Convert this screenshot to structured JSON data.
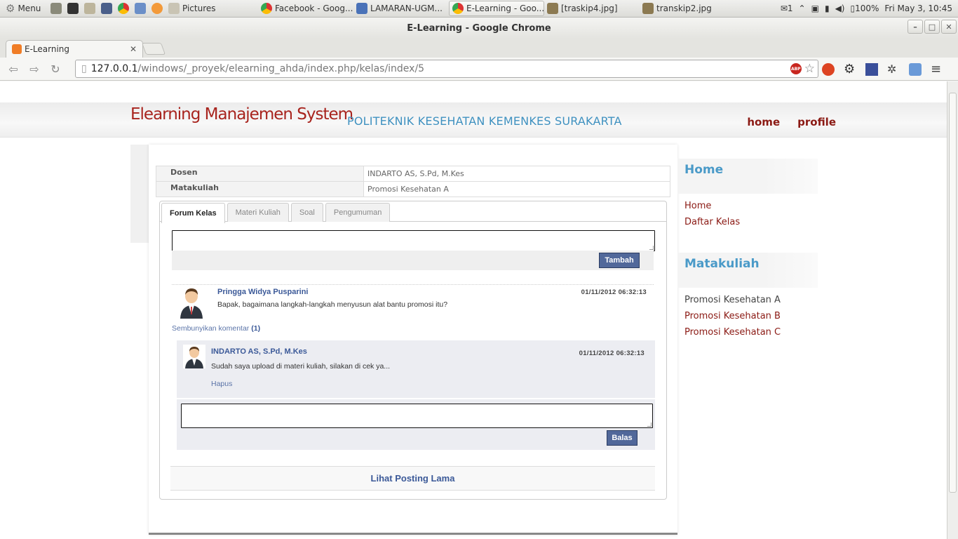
{
  "system_panel": {
    "menu_label": "Menu",
    "tasks": [
      {
        "label": "Pictures",
        "active": false
      },
      {
        "label": "Facebook - Goog...",
        "active": false
      },
      {
        "label": "LAMARAN-UGM...",
        "active": false
      },
      {
        "label": "E-Learning - Goo...",
        "active": true
      },
      {
        "label": "[traskip4.jpg]",
        "active": false
      },
      {
        "label": "transkip2.jpg",
        "active": false
      }
    ],
    "tray": {
      "message_count": "1",
      "battery": "100%",
      "clock": "Fri May  3, 10:45"
    }
  },
  "window": {
    "title": "E-Learning - Google Chrome"
  },
  "browser": {
    "tab_title": "E-Learning",
    "url_host": "127.0.0.1",
    "url_path": "/windows/_proyek/elearning_ahda/index.php/kelas/index/5",
    "abp_label": "ABP"
  },
  "site": {
    "brand": "Elearning Manajemen System",
    "institution": "POLITEKNIK KESEHATAN KEMENKES SURAKARTA",
    "nav": [
      "home",
      "profile"
    ]
  },
  "course_info": [
    {
      "label": "Dosen",
      "value": "INDARTO AS, S.Pd, M.Kes"
    },
    {
      "label": "Matakuliah",
      "value": "Promosi Kesehatan A"
    }
  ],
  "tabs": [
    "Forum Kelas",
    "Materi Kuliah",
    "Soal",
    "Pengumuman"
  ],
  "forum": {
    "add_button": "Tambah",
    "post": {
      "author": "Pringga Widya Pusparini",
      "date": "01/11/2012 06:32:13",
      "text": "Bapak, bagaimana langkah-langkah menyusun alat bantu promosi itu?"
    },
    "hide_comments_label": "Sembunyikan komentar",
    "comment_count": "(1)",
    "comment": {
      "author": "INDARTO AS, S.Pd, M.Kes",
      "date": "01/11/2012 06:32:13",
      "text": "Sudah saya upload di materi kuliah, silakan di cek ya...",
      "delete_label": "Hapus"
    },
    "reply_button": "Balas",
    "older_posts": "Lihat Posting Lama"
  },
  "sidebar": {
    "home_heading": "Home",
    "home_links": [
      "Home",
      "Daftar Kelas"
    ],
    "course_heading": "Matakuliah",
    "courses": [
      "Promosi Kesehatan A",
      "Promosi Kesehatan B",
      "Promosi Kesehatan C"
    ]
  },
  "colors": {
    "brand_red": "#a8241e",
    "accent_blue": "#4a9ac8",
    "link_blue": "#3b5998",
    "button_blue": "#51689a"
  }
}
